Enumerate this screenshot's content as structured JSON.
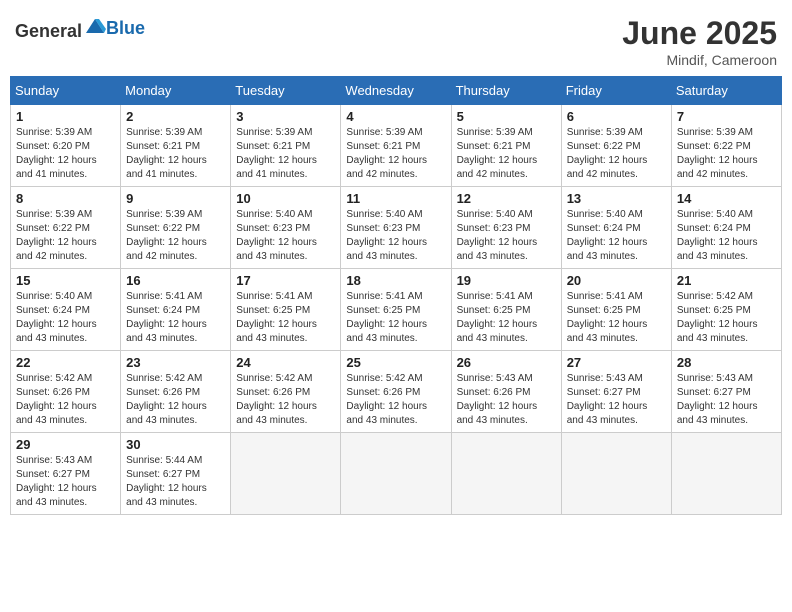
{
  "logo": {
    "text_general": "General",
    "text_blue": "Blue"
  },
  "header": {
    "title": "June 2025",
    "subtitle": "Mindif, Cameroon"
  },
  "weekdays": [
    "Sunday",
    "Monday",
    "Tuesday",
    "Wednesday",
    "Thursday",
    "Friday",
    "Saturday"
  ],
  "weeks": [
    [
      {
        "day": "1",
        "sunrise": "5:39 AM",
        "sunset": "6:20 PM",
        "daylight": "12 hours and 41 minutes."
      },
      {
        "day": "2",
        "sunrise": "5:39 AM",
        "sunset": "6:21 PM",
        "daylight": "12 hours and 41 minutes."
      },
      {
        "day": "3",
        "sunrise": "5:39 AM",
        "sunset": "6:21 PM",
        "daylight": "12 hours and 41 minutes."
      },
      {
        "day": "4",
        "sunrise": "5:39 AM",
        "sunset": "6:21 PM",
        "daylight": "12 hours and 42 minutes."
      },
      {
        "day": "5",
        "sunrise": "5:39 AM",
        "sunset": "6:21 PM",
        "daylight": "12 hours and 42 minutes."
      },
      {
        "day": "6",
        "sunrise": "5:39 AM",
        "sunset": "6:22 PM",
        "daylight": "12 hours and 42 minutes."
      },
      {
        "day": "7",
        "sunrise": "5:39 AM",
        "sunset": "6:22 PM",
        "daylight": "12 hours and 42 minutes."
      }
    ],
    [
      {
        "day": "8",
        "sunrise": "5:39 AM",
        "sunset": "6:22 PM",
        "daylight": "12 hours and 42 minutes."
      },
      {
        "day": "9",
        "sunrise": "5:39 AM",
        "sunset": "6:22 PM",
        "daylight": "12 hours and 42 minutes."
      },
      {
        "day": "10",
        "sunrise": "5:40 AM",
        "sunset": "6:23 PM",
        "daylight": "12 hours and 43 minutes."
      },
      {
        "day": "11",
        "sunrise": "5:40 AM",
        "sunset": "6:23 PM",
        "daylight": "12 hours and 43 minutes."
      },
      {
        "day": "12",
        "sunrise": "5:40 AM",
        "sunset": "6:23 PM",
        "daylight": "12 hours and 43 minutes."
      },
      {
        "day": "13",
        "sunrise": "5:40 AM",
        "sunset": "6:24 PM",
        "daylight": "12 hours and 43 minutes."
      },
      {
        "day": "14",
        "sunrise": "5:40 AM",
        "sunset": "6:24 PM",
        "daylight": "12 hours and 43 minutes."
      }
    ],
    [
      {
        "day": "15",
        "sunrise": "5:40 AM",
        "sunset": "6:24 PM",
        "daylight": "12 hours and 43 minutes."
      },
      {
        "day": "16",
        "sunrise": "5:41 AM",
        "sunset": "6:24 PM",
        "daylight": "12 hours and 43 minutes."
      },
      {
        "day": "17",
        "sunrise": "5:41 AM",
        "sunset": "6:25 PM",
        "daylight": "12 hours and 43 minutes."
      },
      {
        "day": "18",
        "sunrise": "5:41 AM",
        "sunset": "6:25 PM",
        "daylight": "12 hours and 43 minutes."
      },
      {
        "day": "19",
        "sunrise": "5:41 AM",
        "sunset": "6:25 PM",
        "daylight": "12 hours and 43 minutes."
      },
      {
        "day": "20",
        "sunrise": "5:41 AM",
        "sunset": "6:25 PM",
        "daylight": "12 hours and 43 minutes."
      },
      {
        "day": "21",
        "sunrise": "5:42 AM",
        "sunset": "6:25 PM",
        "daylight": "12 hours and 43 minutes."
      }
    ],
    [
      {
        "day": "22",
        "sunrise": "5:42 AM",
        "sunset": "6:26 PM",
        "daylight": "12 hours and 43 minutes."
      },
      {
        "day": "23",
        "sunrise": "5:42 AM",
        "sunset": "6:26 PM",
        "daylight": "12 hours and 43 minutes."
      },
      {
        "day": "24",
        "sunrise": "5:42 AM",
        "sunset": "6:26 PM",
        "daylight": "12 hours and 43 minutes."
      },
      {
        "day": "25",
        "sunrise": "5:42 AM",
        "sunset": "6:26 PM",
        "daylight": "12 hours and 43 minutes."
      },
      {
        "day": "26",
        "sunrise": "5:43 AM",
        "sunset": "6:26 PM",
        "daylight": "12 hours and 43 minutes."
      },
      {
        "day": "27",
        "sunrise": "5:43 AM",
        "sunset": "6:27 PM",
        "daylight": "12 hours and 43 minutes."
      },
      {
        "day": "28",
        "sunrise": "5:43 AM",
        "sunset": "6:27 PM",
        "daylight": "12 hours and 43 minutes."
      }
    ],
    [
      {
        "day": "29",
        "sunrise": "5:43 AM",
        "sunset": "6:27 PM",
        "daylight": "12 hours and 43 minutes."
      },
      {
        "day": "30",
        "sunrise": "5:44 AM",
        "sunset": "6:27 PM",
        "daylight": "12 hours and 43 minutes."
      },
      {
        "day": "",
        "sunrise": "",
        "sunset": "",
        "daylight": ""
      },
      {
        "day": "",
        "sunrise": "",
        "sunset": "",
        "daylight": ""
      },
      {
        "day": "",
        "sunrise": "",
        "sunset": "",
        "daylight": ""
      },
      {
        "day": "",
        "sunrise": "",
        "sunset": "",
        "daylight": ""
      },
      {
        "day": "",
        "sunrise": "",
        "sunset": "",
        "daylight": ""
      }
    ]
  ],
  "labels": {
    "sunrise": "Sunrise:",
    "sunset": "Sunset:",
    "daylight": "Daylight:"
  }
}
